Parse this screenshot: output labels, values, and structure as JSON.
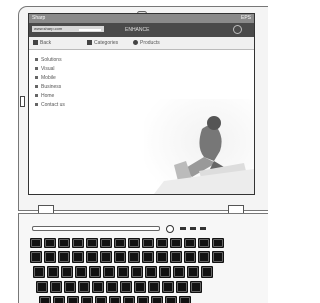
{
  "browser": {
    "title": "Sharp",
    "title_right": "EPS",
    "url": "www.sharp.com",
    "page_header": "ENHANCE",
    "toolbar": [
      {
        "label": "Back",
        "icon": "bookmark-icon"
      },
      {
        "label": "Categories",
        "icon": "list-icon"
      },
      {
        "label": "Products",
        "icon": "circle-icon"
      }
    ]
  },
  "content": {
    "items": [
      "Solutions",
      "Visual",
      "Mobile",
      "Business",
      "Home",
      "Contact us"
    ]
  },
  "colors": {
    "titlebar": "#8a8a8a",
    "addressbar": "#4a4a4a",
    "keys": "#111111",
    "bezel": "#f4f4f4"
  }
}
